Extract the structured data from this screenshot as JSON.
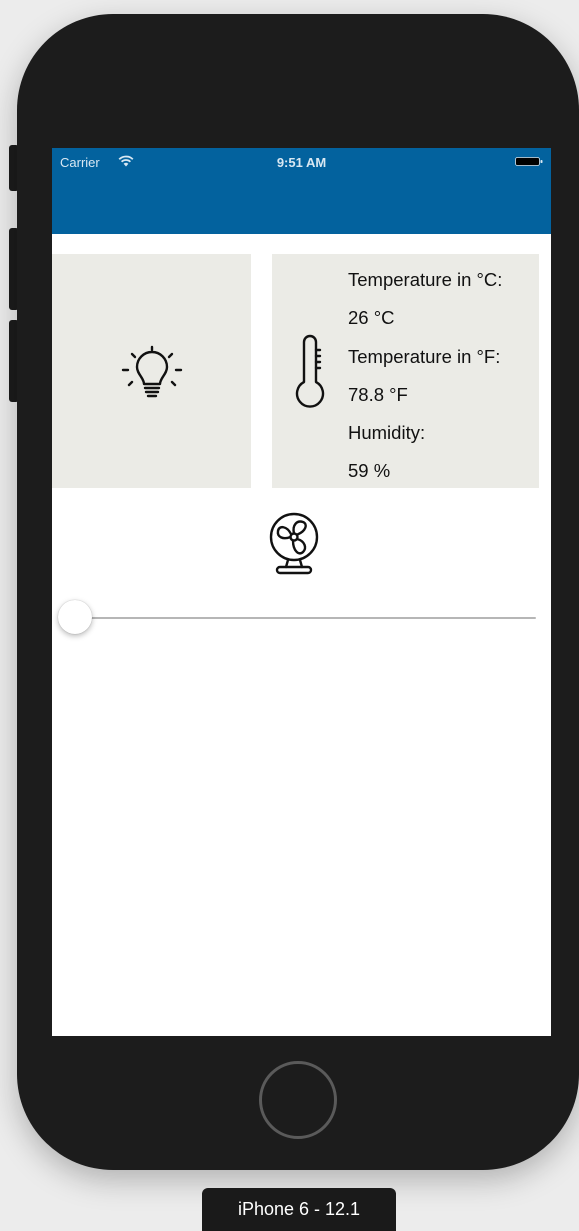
{
  "status_bar": {
    "carrier": "Carrier",
    "time": "9:51 AM"
  },
  "colors": {
    "nav_bar": "#03629e",
    "tile_background": "#ebebe6",
    "phone_body": "#1c1c1c"
  },
  "light_tile": {
    "icon": "lightbulb-icon"
  },
  "climate_tile": {
    "icon": "thermometer-icon",
    "temp_c_label": "Temperature in °C:",
    "temp_c_value": "26 °C",
    "temp_f_label": "Temperature in °F:",
    "temp_f_value": "78.8 °F",
    "humidity_label": "Humidity:",
    "humidity_value": "59 %"
  },
  "fan": {
    "icon": "fan-icon",
    "speed_fraction": 0.0
  },
  "simulator": {
    "device_label": "iPhone 6 - 12.1"
  }
}
